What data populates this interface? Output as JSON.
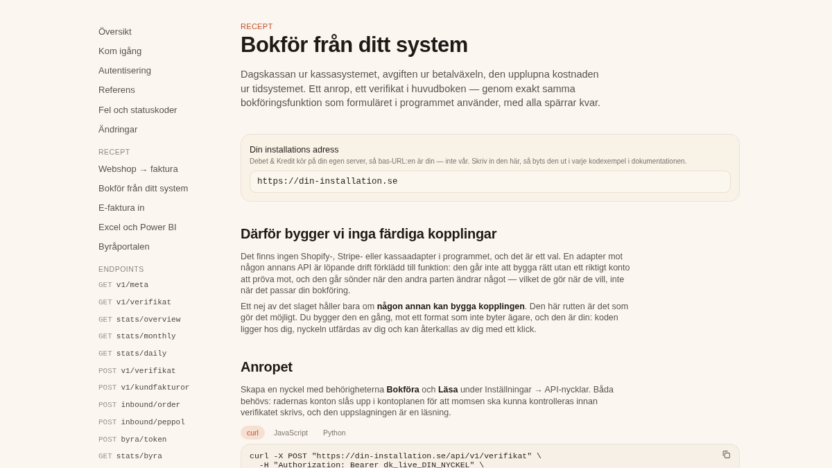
{
  "sidebar": {
    "items": [
      {
        "label": "Översikt"
      },
      {
        "label": "Kom igång"
      },
      {
        "label": "Autentisering"
      },
      {
        "label": "Referens"
      },
      {
        "label": "Fel och statuskoder"
      },
      {
        "label": "Ändringar"
      }
    ],
    "sections": [
      {
        "heading": "RECEPT",
        "kind": "links",
        "items": [
          {
            "label": "Webshop → faktura"
          },
          {
            "label": "Bokför från ditt system"
          },
          {
            "label": "E-faktura in"
          },
          {
            "label": "Excel och Power BI"
          },
          {
            "label": "Byråportalen"
          }
        ]
      },
      {
        "heading": "ENDPOINTS",
        "kind": "endpoints",
        "items": [
          {
            "method": "GET",
            "path": "v1/meta"
          },
          {
            "method": "GET",
            "path": "v1/verifikat"
          },
          {
            "method": "GET",
            "path": "stats/overview"
          },
          {
            "method": "GET",
            "path": "stats/monthly"
          },
          {
            "method": "GET",
            "path": "stats/daily"
          },
          {
            "method": "POST",
            "path": "v1/verifikat"
          },
          {
            "method": "POST",
            "path": "v1/kundfakturor"
          },
          {
            "method": "POST",
            "path": "inbound/order"
          },
          {
            "method": "POST",
            "path": "inbound/peppol"
          },
          {
            "method": "POST",
            "path": "byra/token"
          },
          {
            "method": "GET",
            "path": "stats/byra"
          }
        ]
      }
    ]
  },
  "article": {
    "eyebrow": "RECEPT",
    "title": "Bokför från ditt system",
    "lead": "Dagskassan ur kassasystemet, avgiften ur betalväxeln, den upplupna kostnaden ur tidsystemet. Ett anrop, ett verifikat i huvudboken — genom exakt samma bokföringsfunktion som formuläret i programmet använder, med alla spärrar kvar.",
    "install_card": {
      "title": "Din installations adress",
      "hint": "Debet & Kredit kör på din egen server, så bas-URL:en är din — inte vår. Skriv in den här, så byts den ut i varje kodexempel i dokumentationen.",
      "value": "https://din-installation.se"
    },
    "sections": [
      {
        "heading": "Därför bygger vi inga färdiga kopplingar",
        "paragraphs": [
          "Det finns ingen Shopify-, Stripe- eller kassaadapter i programmet, och det är ett val. En adapter mot någon annans API är löpande drift förklädd till funktion: den går inte att bygga rätt utan ett riktigt konto att pröva mot, och den går sönder när den andra parten ändrar något — vilket de gör när de vill, inte när det passar din bokföring.",
          "Ett nej av det slaget håller bara om **någon annan kan bygga kopplingen**. Den här rutten är det som gör det möjligt. Du bygger den en gång, mot ett format som inte byter ägare, och den är din: koden ligger hos dig, nyckeln utfärdas av dig och kan återkallas av dig med ett klick."
        ]
      },
      {
        "heading": "Anropet",
        "paragraphs": [
          "Skapa en nyckel med behörigheterna **Bokföra** och **Läsa** under Inställningar → API-nycklar. Båda behövs: radernas konton slås upp i kontoplanen för att momsen ska kunna kontrolleras innan verifikatet skrivs, och den uppslagningen är en läsning."
        ]
      }
    ],
    "code_tabs": [
      {
        "label": "curl",
        "selected": true
      },
      {
        "label": "JavaScript",
        "selected": false
      },
      {
        "label": "Python",
        "selected": false
      }
    ],
    "code_lines": [
      "curl -X POST \"https://din-installation.se/api/v1/verifikat\" \\",
      "  -H \"Authorization: Bearer dk_live_DIN_NYCKEL\" \\"
    ]
  }
}
